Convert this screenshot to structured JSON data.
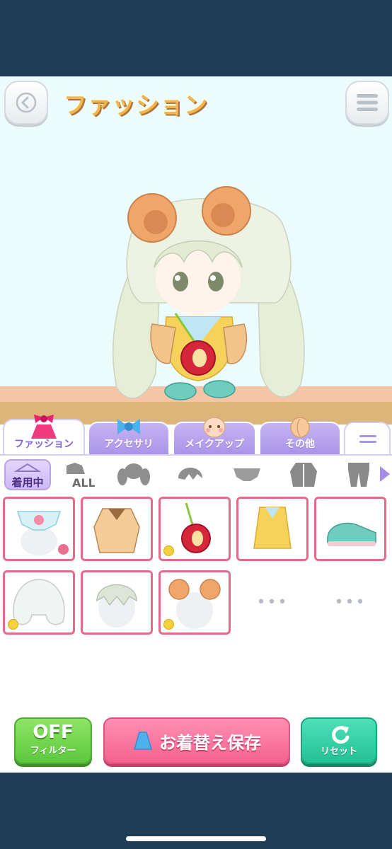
{
  "header": {
    "title": "ファッション",
    "back_icon": "chevron-left-icon",
    "menu_icon": "hamburger-menu-icon"
  },
  "tabs": [
    {
      "label": "ファッション",
      "icon": "ribbon-dress-icon",
      "active": true
    },
    {
      "label": "アクセサリ",
      "icon": "blue-bow-icon",
      "active": false
    },
    {
      "label": "メイクアップ",
      "icon": "face-icon",
      "active": false
    },
    {
      "label": "その他",
      "icon": "misc-icon",
      "active": false
    },
    {
      "label": "",
      "icon": "more-menu-icon",
      "active": false
    }
  ],
  "categories": {
    "wearing_label": "着用中",
    "all_label": "ALL",
    "items": [
      "all-icon",
      "twin-tails-icon",
      "bangs-icon",
      "underwear-icon",
      "jacket-icon",
      "pants-icon"
    ]
  },
  "grid": {
    "items": [
      {
        "name": "underwear-item",
        "badge": "pin"
      },
      {
        "name": "jacket-item",
        "badge": ""
      },
      {
        "name": "apple-bag-item",
        "badge": "hint"
      },
      {
        "name": "yellow-dress-item",
        "badge": ""
      },
      {
        "name": "mint-sneakers-item",
        "badge": ""
      },
      {
        "name": "wavy-hair-item",
        "badge": "hint"
      },
      {
        "name": "bangs-hair-item",
        "badge": ""
      },
      {
        "name": "bear-ears-item",
        "badge": "hint"
      }
    ],
    "empty_label": "•••"
  },
  "buttons": {
    "filter_big": "OFF",
    "filter_small": "フィルター",
    "save_label": "お着替え保存",
    "reset_label": "リセット"
  },
  "colors": {
    "accent_purple": "#a995e8",
    "cell_border": "#e86a8a",
    "save_pink": "#f3628f",
    "filter_green": "#5cc83e",
    "reset_teal": "#23c193"
  }
}
